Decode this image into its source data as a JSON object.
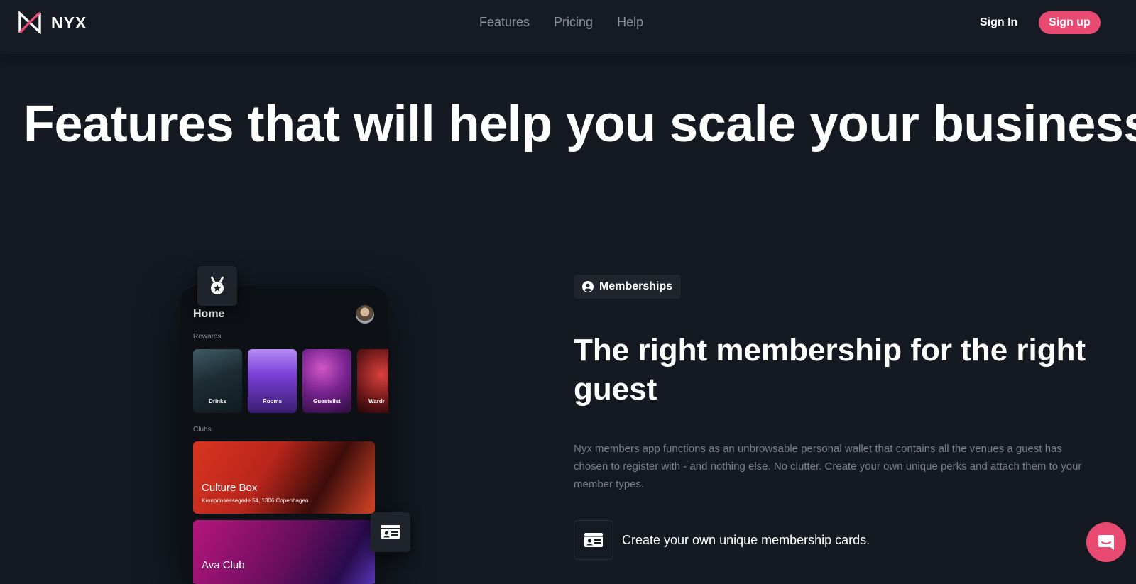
{
  "brand": {
    "name": "NYX",
    "accent": "#e84a72"
  },
  "nav": {
    "links": [
      {
        "label": "Features"
      },
      {
        "label": "Pricing"
      },
      {
        "label": "Help"
      }
    ],
    "sign_in": "Sign In",
    "sign_up": "Sign up"
  },
  "hero": {
    "title": "Features that will help you scale your business"
  },
  "phone": {
    "home_title": "Home",
    "rewards_label": "Rewards",
    "rewards": [
      {
        "label": "Drinks"
      },
      {
        "label": "Rooms"
      },
      {
        "label": "Guestslist"
      },
      {
        "label": "Wardr"
      }
    ],
    "clubs_label": "Clubs",
    "clubs": [
      {
        "name": "Culture Box",
        "address": "Kronprinsessegade 54, 1306 Copenhagen"
      },
      {
        "name": "Ava Club"
      }
    ]
  },
  "section": {
    "tag": "Memberships",
    "tag_icon": "user-circle-icon",
    "title": "The right membership for the right guest",
    "description": "Nyx members app functions as an unbrowsable personal wallet that contains all the venues a guest has chosen to register with - and nothing else. No clutter. Create your own unique perks and attach them to your member types.",
    "features": [
      {
        "icon": "id-card-icon",
        "text": "Create your own unique membership cards."
      }
    ]
  },
  "chat": {
    "icon": "chat-icon"
  }
}
